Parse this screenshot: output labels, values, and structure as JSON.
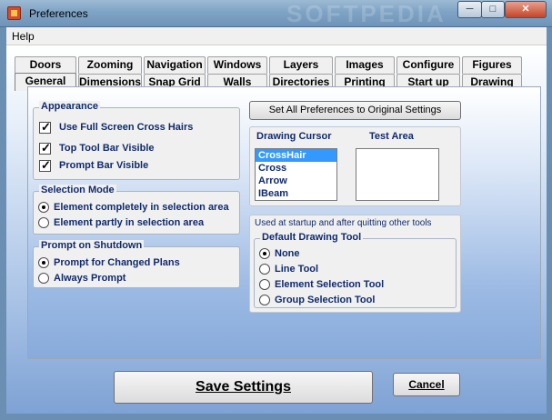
{
  "window": {
    "title": "Preferences",
    "watermark": "SOFTPEDIA",
    "minimize_glyph": "─",
    "maximize_glyph": "□",
    "close_glyph": "✕"
  },
  "menubar": {
    "help": "Help"
  },
  "tabs": {
    "row1": [
      "Doors",
      "Zooming",
      "Navigation",
      "Windows",
      "Layers",
      "Images",
      "Configure",
      "Figures"
    ],
    "row2": [
      "General",
      "Dimensions",
      "Snap Grid",
      "Walls",
      "Directories",
      "Printing",
      "Start up",
      "Drawing"
    ],
    "active": "General"
  },
  "appearance": {
    "label": "Appearance",
    "options": [
      {
        "label": "Use Full Screen Cross Hairs",
        "checked": true
      },
      {
        "label": "Top Tool Bar Visible",
        "checked": true
      },
      {
        "label": "Prompt Bar Visible",
        "checked": true
      }
    ],
    "check_glyph": "✓"
  },
  "selection_mode": {
    "label": "Selection Mode",
    "options": [
      {
        "label": "Element completely in selection area",
        "selected": true
      },
      {
        "label": "Element partly in selection area",
        "selected": false
      }
    ]
  },
  "prompt_on_shutdown": {
    "label": "Prompt on Shutdown",
    "options": [
      {
        "label": "Prompt for Changed Plans",
        "selected": true
      },
      {
        "label": "Always Prompt",
        "selected": false
      }
    ]
  },
  "reset_button": "Set All Preferences to Original Settings",
  "drawing_cursor": {
    "label": "Drawing Cursor",
    "items": [
      "CrossHair",
      "Cross",
      "Arrow",
      "IBeam"
    ],
    "selected": "CrossHair",
    "test_area_label": "Test Area"
  },
  "default_tool": {
    "caption": "Used at startup and after quitting other tools",
    "label": "Default Drawing Tool",
    "options": [
      {
        "label": "None",
        "selected": true
      },
      {
        "label": "Line Tool",
        "selected": false
      },
      {
        "label": "Element Selection Tool",
        "selected": false
      },
      {
        "label": "Group Selection Tool",
        "selected": false
      }
    ]
  },
  "footer": {
    "save": "Save Settings",
    "cancel": "Cancel"
  }
}
